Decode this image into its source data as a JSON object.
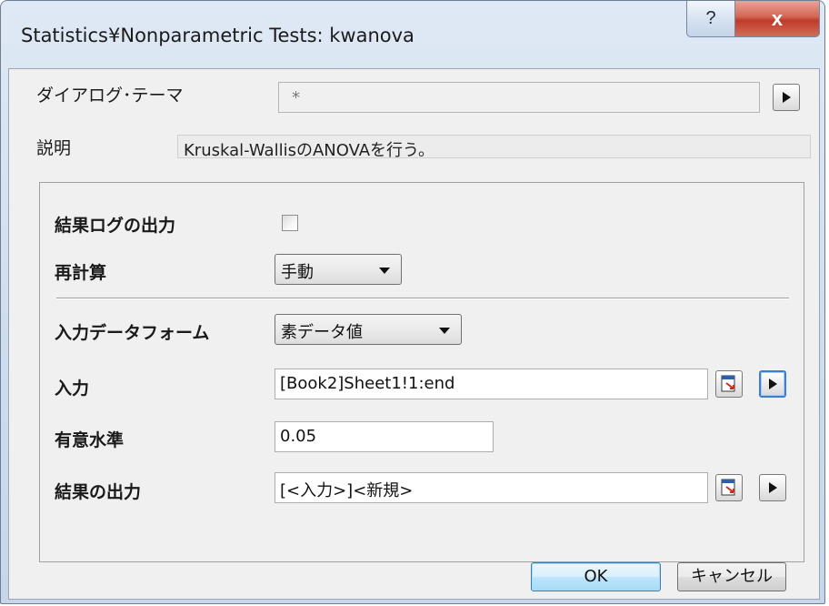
{
  "window": {
    "title": "Statistics¥Nonparametric Tests: kwanova",
    "help_label": "?",
    "close_label": "x",
    "accent": "#c8402c"
  },
  "theme": {
    "label": "ダイアログ･テーマ",
    "value": "*"
  },
  "description": {
    "label": "説明",
    "value": "Kruskal-WallisのANOVAを行う。"
  },
  "options": {
    "result_log_label": "結果ログの出力",
    "result_log_checked": false,
    "recalc_label": "再計算",
    "recalc_value": "手動"
  },
  "input": {
    "form_label": "入力データフォーム",
    "form_value": "素データ値",
    "input_label": "入力",
    "input_value": "[Book2]Sheet1!1:end",
    "significance_label": "有意水準",
    "significance_value": "0.05",
    "output_label": "結果の出力",
    "output_value": "[<入力>]<新規>"
  },
  "footer": {
    "ok_label": "OK",
    "cancel_label": "キャンセル"
  },
  "icons": {
    "expand": "triangle-right-icon",
    "range_select": "range-select-icon"
  }
}
